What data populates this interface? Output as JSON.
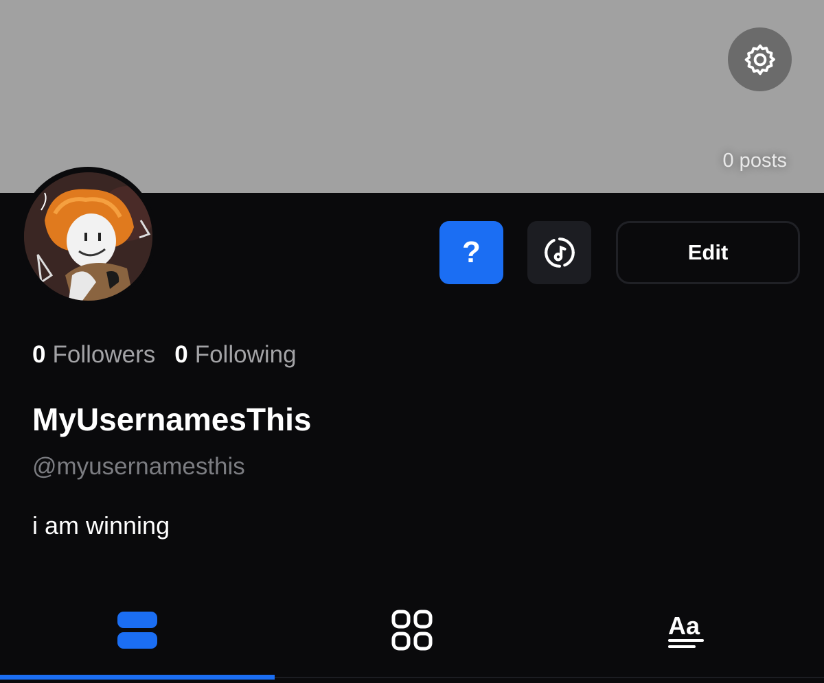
{
  "banner": {
    "color": "#a1a1a1",
    "settings_icon": "gear-icon",
    "posts_label": "0 posts"
  },
  "profile": {
    "avatar_alt": "avatar",
    "display_name": "MyUsernamesThis",
    "handle": "@myusernamesthis",
    "bio": "i am winning"
  },
  "actions": {
    "help_icon": "question-icon",
    "help_glyph": "?",
    "music_icon": "music-note-icon",
    "edit_label": "Edit"
  },
  "stats": {
    "followers_count": "0",
    "followers_label": "Followers",
    "following_count": "0",
    "following_label": "Following"
  },
  "tabs": [
    {
      "icon": "list-view-icon",
      "active": true
    },
    {
      "icon": "grid-view-icon",
      "active": false
    },
    {
      "icon": "text-posts-icon",
      "active": false
    }
  ],
  "colors": {
    "accent": "#1b6ef3",
    "background": "#0a0a0c",
    "muted": "#a3a3a6"
  }
}
